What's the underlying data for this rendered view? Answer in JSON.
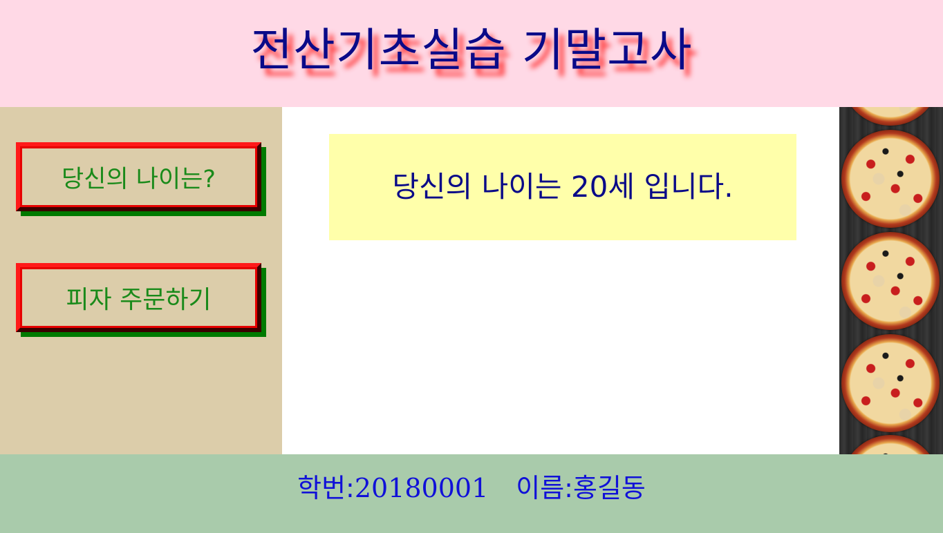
{
  "header": {
    "title": "전산기초실습 기말고사"
  },
  "sidebar": {
    "buttons": [
      {
        "label": "당신의 나이는?"
      },
      {
        "label": "피자 주문하기"
      }
    ]
  },
  "main": {
    "result_text": "당신의 나이는 20세 입니다."
  },
  "footer": {
    "student_id_label": "학번:",
    "student_id": "20180001",
    "name_label": "이름:",
    "name": "홍길동"
  },
  "colors": {
    "header_bg": "#ffd9e6",
    "title_color": "#0a0a88",
    "title_shadow": "#ff2a2a",
    "sidebar_bg": "#dccdaa",
    "button_text": "#1a8a1a",
    "button_border": "#ff1a1a",
    "button_shadow": "#007a00",
    "result_bg": "#ffffaa",
    "footer_bg": "#a9cbab",
    "footer_text": "#1010d8"
  },
  "icons": {
    "pizza_strip": "pizza-image"
  }
}
